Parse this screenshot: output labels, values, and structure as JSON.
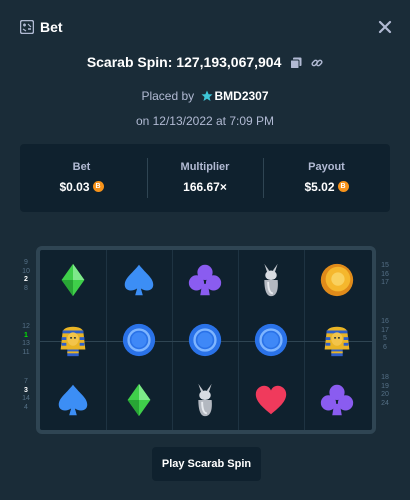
{
  "header": {
    "title": "Bet",
    "icon": "bet-slip-icon",
    "close_icon": "close-icon"
  },
  "spin": {
    "title": "Scarab Spin: 127,193,067,904",
    "copy_icon": "copy-icon",
    "link_icon": "link-icon"
  },
  "placed": {
    "prefix": "Placed by",
    "user": "BMD2307",
    "user_icon": "star-icon",
    "date": "on 12/13/2022 at 7:09 PM"
  },
  "stats": {
    "bet_label": "Bet",
    "bet_value": "$0.03",
    "multiplier_label": "Multiplier",
    "multiplier_value": "166.67×",
    "payout_label": "Payout",
    "payout_value": "$5.02",
    "currency_icon": "bitcoin-icon"
  },
  "reels": [
    [
      "green-diamond-icon",
      "pharaoh-icon",
      "blue-spade-icon"
    ],
    [
      "blue-spade-icon",
      "blue-gem-icon",
      "green-diamond-icon"
    ],
    [
      "purple-club-icon",
      "blue-gem-icon",
      "anubis-statue-icon"
    ],
    [
      "anubis-statue-icon",
      "blue-gem-icon",
      "red-heart-icon"
    ],
    [
      "gold-coin-icon",
      "pharaoh-icon",
      "purple-club-icon"
    ]
  ],
  "paylines": {
    "left_top": [
      "9",
      "10",
      "2",
      "8"
    ],
    "left_mid": [
      "12",
      "1",
      "13",
      "11"
    ],
    "left_bot": [
      "7",
      "3",
      "14",
      "4"
    ],
    "right_top": [
      "15",
      "16",
      "17"
    ],
    "right_mid": [
      "16",
      "17",
      "5",
      "6"
    ],
    "right_bot": [
      "18",
      "19",
      "20",
      "24"
    ]
  },
  "colors": {
    "background": "#1a2c38",
    "panel": "#0f212e",
    "muted": "#b1bad3",
    "payout": "#00e701"
  },
  "actions": {
    "play_label": "Play Scarab Spin"
  }
}
